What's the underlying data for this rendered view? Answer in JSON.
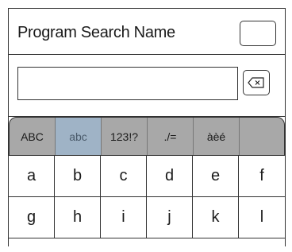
{
  "header": {
    "title": "Program Search Name"
  },
  "search": {
    "value": "",
    "placeholder": ""
  },
  "mode_tabs": [
    {
      "label": "ABC",
      "active": false
    },
    {
      "label": "abc",
      "active": true
    },
    {
      "label": "123!?",
      "active": false
    },
    {
      "label": "./=",
      "active": false
    },
    {
      "label": "àèé",
      "active": false
    },
    {
      "label": "",
      "active": false
    }
  ],
  "keys": {
    "row1": [
      "a",
      "b",
      "c",
      "d",
      "e",
      "f"
    ],
    "row2": [
      "g",
      "h",
      "i",
      "j",
      "k",
      "l"
    ]
  },
  "icons": {
    "backspace": "backspace-icon"
  },
  "colors": {
    "mode_bar": "#a8a8a8",
    "active_tab": "#9fb3c6"
  }
}
